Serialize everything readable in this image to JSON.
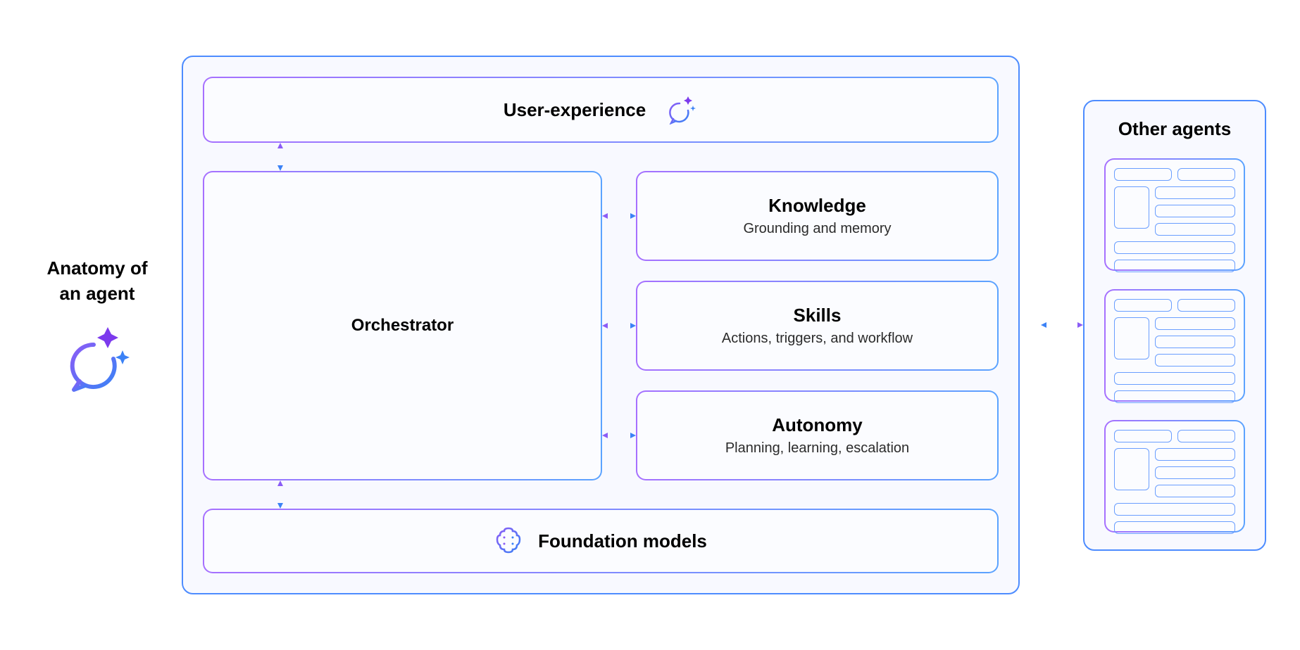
{
  "leftLabel": "Anatomy of an agent",
  "main": {
    "userExperience": "User-experience",
    "orchestrator": "Orchestrator",
    "knowledge": {
      "title": "Knowledge",
      "subtitle": "Grounding and memory"
    },
    "skills": {
      "title": "Skills",
      "subtitle": "Actions, triggers, and workflow"
    },
    "autonomy": {
      "title": "Autonomy",
      "subtitle": "Planning, learning, escalation"
    },
    "foundation": "Foundation models"
  },
  "otherAgents": "Other agents"
}
